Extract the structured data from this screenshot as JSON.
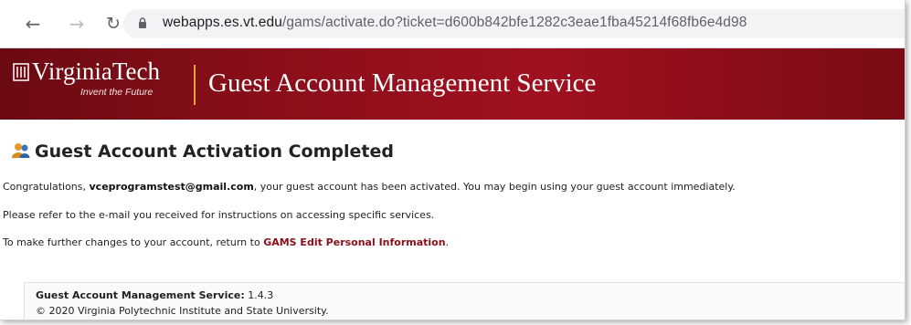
{
  "browser": {
    "url_host": "webapps.es.vt.edu",
    "url_path": "/gams/activate.do?ticket=d600b842bfe1282c3eae1fba45214f68fb6e4d98",
    "icons": [
      "back-arrow-icon",
      "forward-arrow-icon",
      "reload-icon",
      "lock-icon"
    ]
  },
  "banner": {
    "logo_text": "VirginiaTech",
    "logo_tagline": "Invent the Future",
    "title": "Guest Account Management Service",
    "accent_color": "#e8a33d",
    "brand_color": "#8a0f1a"
  },
  "main": {
    "heading": "Guest Account Activation Completed",
    "congrats_prefix": "Congratulations, ",
    "email": "vceprogramstest@gmail.com",
    "congrats_suffix": ", your guest account has been activated. You may begin using your guest account immediately.",
    "instructions": "Please refer to the e-mail you received for instructions on accessing specific services.",
    "changes_prefix": "To make further changes to your account, return to ",
    "changes_link": "GAMS Edit Personal Information",
    "changes_suffix": "."
  },
  "footer": {
    "service_label": "Guest Account Management Service:",
    "version": " 1.4.3",
    "copyright": "© 2020 Virginia Polytechnic Institute and State University."
  }
}
